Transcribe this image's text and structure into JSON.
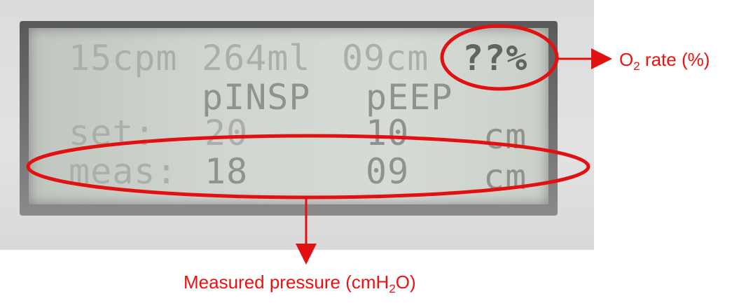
{
  "display": {
    "row1": {
      "rate": "15cpm",
      "volume": "264ml",
      "peep_top": "09cm",
      "o2": "??%"
    },
    "row2": {
      "pinsp_header": "pINSP",
      "peep_header": "pEEP"
    },
    "row3": {
      "label": "set:",
      "pinsp": "20",
      "peep": "10",
      "unit": "cm"
    },
    "row4": {
      "label": "meas:",
      "pinsp": "18",
      "peep": "09",
      "unit": "cm"
    }
  },
  "annotations": {
    "o2_label": {
      "main": "O",
      "sub": "2",
      "rest": " rate (%)"
    },
    "pressure_label": {
      "main": "Measured pressure (cmH",
      "sub": "2",
      "rest": "O)"
    },
    "color": "#e11111"
  }
}
